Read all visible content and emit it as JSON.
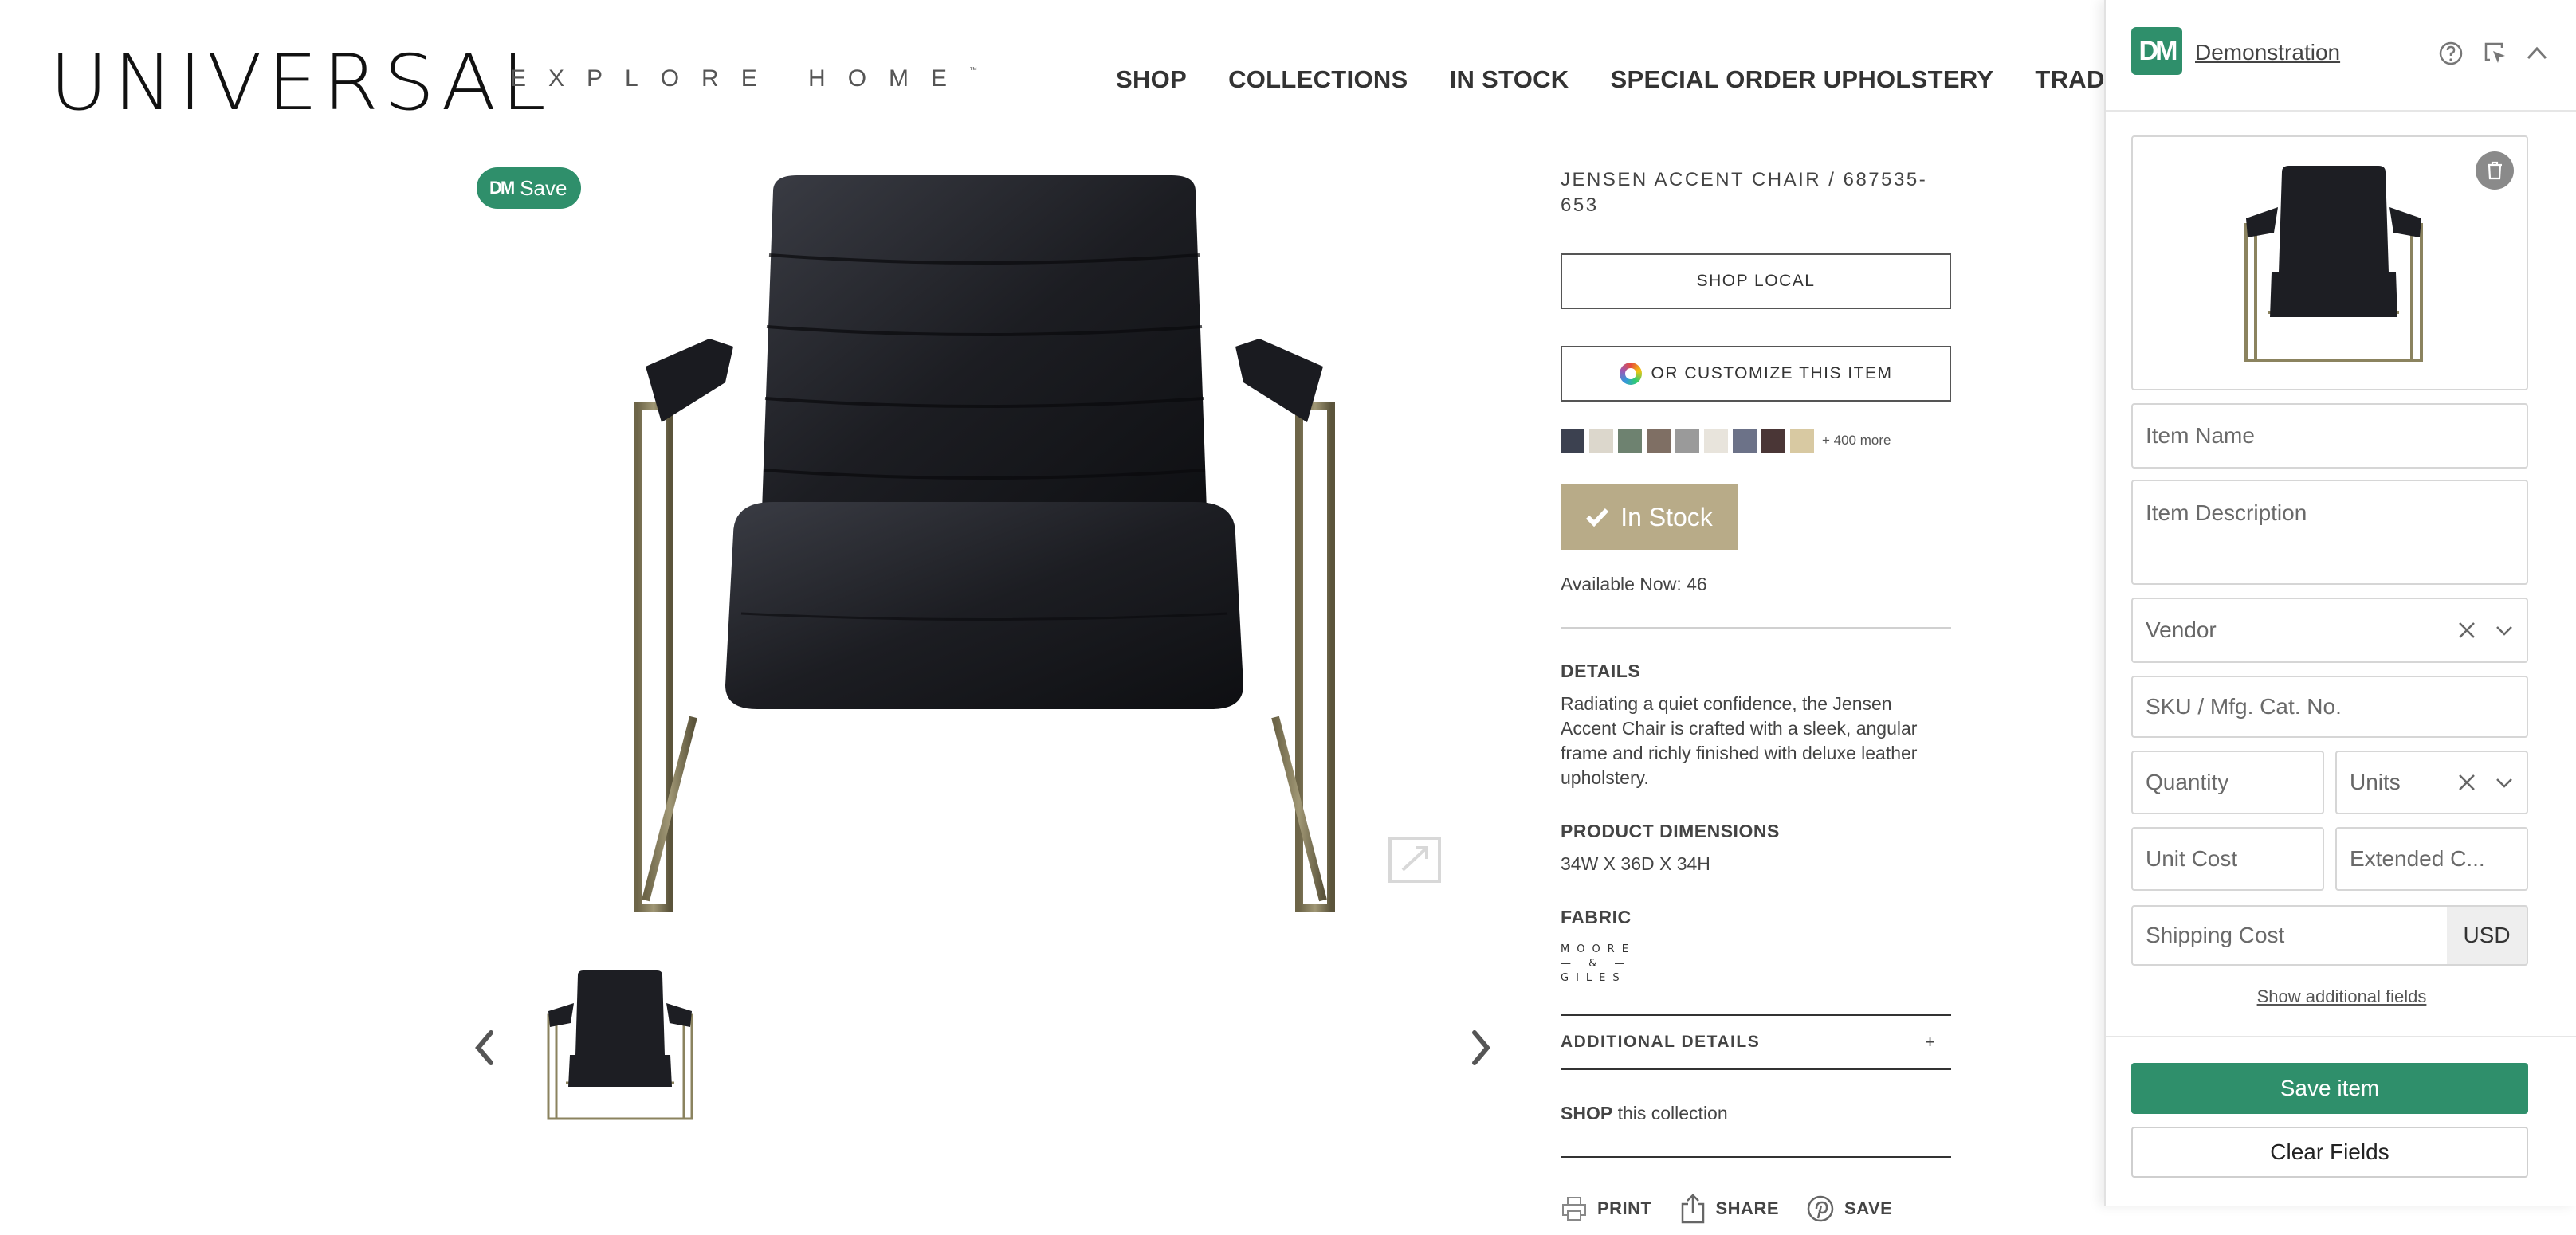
{
  "header": {
    "logo": "UNIVERSAL",
    "logo_sub": "EXPLORE HOME",
    "logo_tm": "™",
    "nav": [
      "SHOP",
      "COLLECTIONS",
      "IN STOCK",
      "SPECIAL ORDER UPHOLSTERY",
      "TRADE"
    ]
  },
  "gallery": {
    "save_badge": "Save",
    "save_badge_logo": "DM",
    "icons": [
      "chair-image",
      "enlarge-icon",
      "thumbnail",
      "prev-arrow-icon",
      "next-arrow-icon"
    ]
  },
  "product": {
    "title": "JENSEN ACCENT CHAIR / 687535-653",
    "shop_local": "SHOP LOCAL",
    "customize": "OR CUSTOMIZE THIS ITEM",
    "swatch_colors": [
      "#3c4150",
      "#dcd7cc",
      "#6e8270",
      "#7f6f64",
      "#9a9a9a",
      "#e8e4dc",
      "#6c7288",
      "#4a3636",
      "#d8c9a2"
    ],
    "more": "+ 400 more",
    "in_stock": "In Stock",
    "available": "Available Now: 46",
    "details_head": "DETAILS",
    "details_text": "Radiating a quiet confidence, the Jensen Accent Chair is crafted with a sleek, angular frame and richly finished with deluxe leather upholstery.",
    "dimensions_head": "PRODUCT DIMENSIONS",
    "dimensions": "34W X 36D X 34H",
    "fabric_head": "FABRIC",
    "fabric_logo": [
      "MOORE",
      "— & —",
      "GILES"
    ],
    "additional": "ADDITIONAL DETAILS",
    "additional_toggle": "+",
    "shop_bold": "SHOP",
    "shop_rest": " this collection",
    "actions": [
      "PRINT",
      "SHARE",
      "SAVE"
    ]
  },
  "panel": {
    "logo": "DM",
    "title": "Demonstration",
    "item_name": "Item Name",
    "item_description": "Item Description",
    "vendor": "Vendor",
    "sku": "SKU / Mfg. Cat. No.",
    "quantity": "Quantity",
    "units": "Units",
    "unit_cost": "Unit Cost",
    "extended_cost": "Extended C...",
    "shipping_cost": "Shipping Cost",
    "currency": "USD",
    "show_more": "Show additional fields",
    "save": "Save item",
    "clear": "Clear Fields",
    "colors": {
      "accent": "#2f8f6b"
    }
  }
}
